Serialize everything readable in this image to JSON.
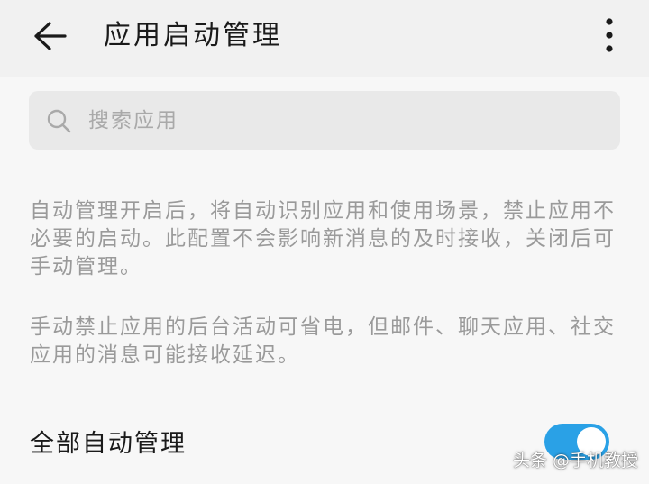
{
  "app_bar": {
    "title": "应用启动管理",
    "back_icon": "arrow-left-icon",
    "more_icon": "more-vertical-icon"
  },
  "search": {
    "placeholder": "搜索应用",
    "value": "",
    "icon": "search-icon"
  },
  "descriptions": [
    "自动管理开启后，将自动识别应用和使用场景，禁止应用不必要的启动。此配置不会影响新消息的及时接收，关闭后可手动管理。",
    "手动禁止应用的后台活动可省电，但邮件、聊天应用、社交应用的消息可能接收延迟。"
  ],
  "auto_manage": {
    "label": "全部自动管理",
    "enabled": true
  },
  "watermark": {
    "text": "头条 @手机教授"
  },
  "colors": {
    "accent": "#2aa1e6",
    "background": "#f7f7f7",
    "app_bar": "#f1f1f1",
    "search_bg": "#e9e9e9",
    "secondary_text": "#9a9a9a"
  }
}
